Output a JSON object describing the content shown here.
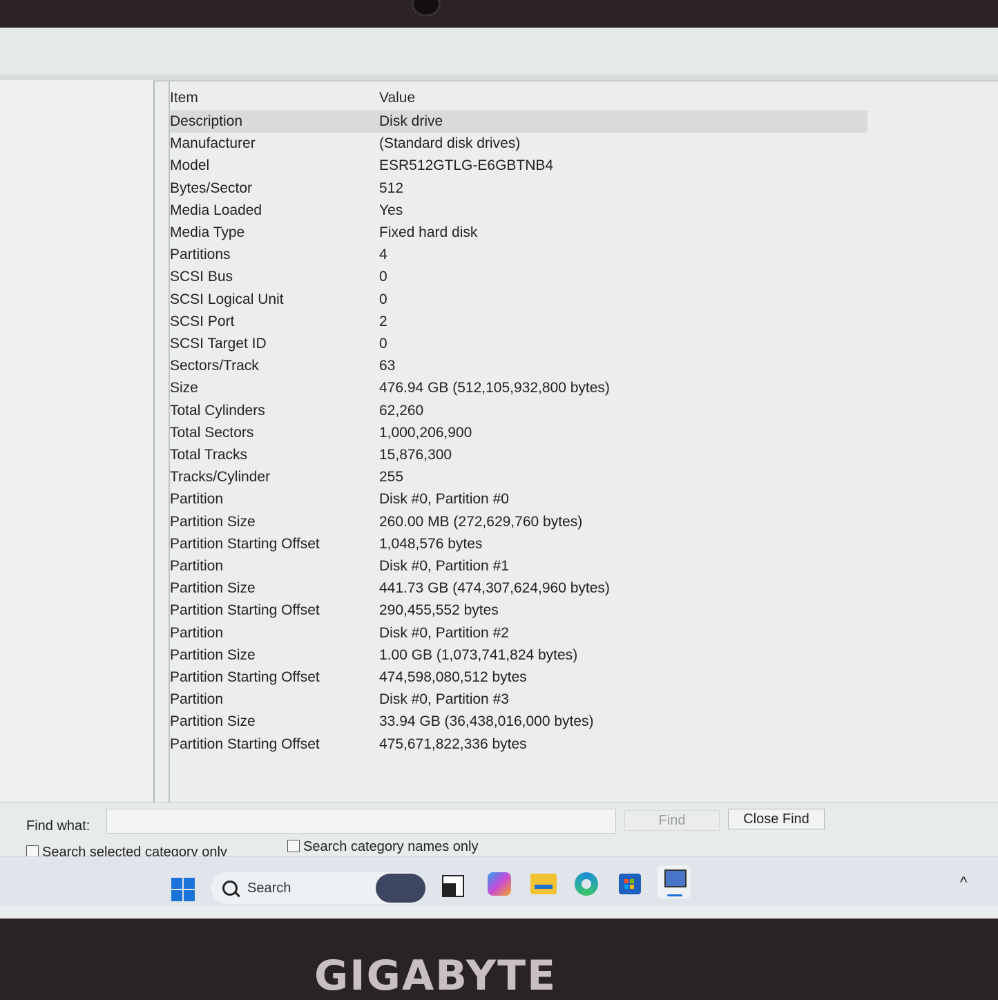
{
  "columns": {
    "item": "Item",
    "value": "Value"
  },
  "rows": [
    {
      "item": "Description",
      "value": "Disk drive"
    },
    {
      "item": "Manufacturer",
      "value": "(Standard disk drives)"
    },
    {
      "item": "Model",
      "value": "ESR512GTLG-E6GBTNB4"
    },
    {
      "item": "Bytes/Sector",
      "value": "512"
    },
    {
      "item": "Media Loaded",
      "value": "Yes"
    },
    {
      "item": "Media Type",
      "value": "Fixed hard disk"
    },
    {
      "item": "Partitions",
      "value": "4"
    },
    {
      "item": "SCSI Bus",
      "value": "0"
    },
    {
      "item": "SCSI Logical Unit",
      "value": "0"
    },
    {
      "item": "SCSI Port",
      "value": "2"
    },
    {
      "item": "SCSI Target ID",
      "value": "0"
    },
    {
      "item": "Sectors/Track",
      "value": "63"
    },
    {
      "item": "Size",
      "value": "476.94 GB (512,105,932,800 bytes)"
    },
    {
      "item": "Total Cylinders",
      "value": "62,260"
    },
    {
      "item": "Total Sectors",
      "value": "1,000,206,900"
    },
    {
      "item": "Total Tracks",
      "value": "15,876,300"
    },
    {
      "item": "Tracks/Cylinder",
      "value": "255"
    },
    {
      "item": "Partition",
      "value": "Disk #0, Partition #0"
    },
    {
      "item": "Partition Size",
      "value": "260.00 MB (272,629,760 bytes)"
    },
    {
      "item": "Partition Starting Offset",
      "value": "1,048,576 bytes"
    },
    {
      "item": "Partition",
      "value": "Disk #0, Partition #1"
    },
    {
      "item": "Partition Size",
      "value": "441.73 GB (474,307,624,960 bytes)"
    },
    {
      "item": "Partition Starting Offset",
      "value": "290,455,552 bytes"
    },
    {
      "item": "Partition",
      "value": "Disk #0, Partition #2"
    },
    {
      "item": "Partition Size",
      "value": "1.00 GB (1,073,741,824 bytes)"
    },
    {
      "item": "Partition Starting Offset",
      "value": "474,598,080,512 bytes"
    },
    {
      "item": "Partition",
      "value": "Disk #0, Partition #3"
    },
    {
      "item": "Partition Size",
      "value": "33.94 GB (36,438,016,000 bytes)"
    },
    {
      "item": "Partition Starting Offset",
      "value": "475,671,822,336 bytes"
    }
  ],
  "find": {
    "label": "Find what:",
    "input_value": "",
    "find_button": "Find",
    "close_button": "Close Find",
    "option_selected_category": "Search selected category only",
    "option_category_names": "Search category names only"
  },
  "taskbar": {
    "search_label": "Search",
    "apps": [
      "start-icon",
      "search-box",
      "task-view-icon",
      "copilot-icon",
      "file-explorer-icon",
      "edge-icon",
      "store-icon",
      "system-information-icon"
    ]
  },
  "brand": "GIGABYTE",
  "colors": {
    "start_blue": "#1a73d9",
    "folder_yellow": "#f1c232",
    "edge_blue": "#1b8fd9"
  }
}
